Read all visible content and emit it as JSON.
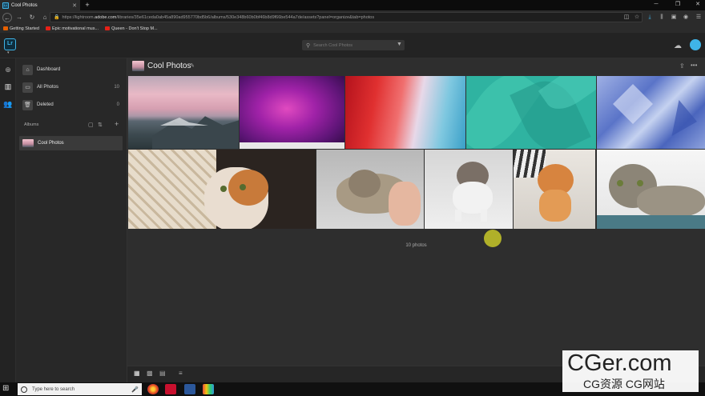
{
  "browser": {
    "tab_title": "Cool Photos",
    "tab_favicon_text": "Lr",
    "url_prefix": "https://lightroom.",
    "url_domain": "adobe.com",
    "url_rest": "/libraries/35e61ceda0ab45a890ad955770bd5b6/albums/530e348b60b0bf46b8d9f66be544a7de/assets?panel=organize&tab=photos",
    "bookmarks": [
      {
        "label": "Getting Started",
        "color": "#e66000"
      },
      {
        "label": "Epic motivational mus...",
        "color": "#e62117"
      },
      {
        "label": "Queen - Don't Stop M...",
        "color": "#e62117"
      }
    ]
  },
  "app": {
    "logo": "Lr",
    "search_placeholder": "Search Cool Photos",
    "accent_color": "#3fb4e8"
  },
  "sidebar": {
    "items": [
      {
        "label": "Dashboard",
        "count": "",
        "icon": "home-icon"
      },
      {
        "label": "All Photos",
        "count": "10",
        "icon": "photos-icon"
      },
      {
        "label": "Deleted",
        "count": "0",
        "icon": "trash-icon"
      }
    ],
    "albums_header": "Albums",
    "albums": [
      {
        "label": "Cool Photos"
      }
    ]
  },
  "main": {
    "album_title": "Cool Photos",
    "photo_count": "10 photos",
    "photos": [
      {
        "name": "pink-mountain-sky"
      },
      {
        "name": "purple-galaxy"
      },
      {
        "name": "red-blue-paint"
      },
      {
        "name": "teal-leaves"
      },
      {
        "name": "blue-crystal"
      },
      {
        "name": "kitten-in-basket"
      },
      {
        "name": "kitten-held-in-hand"
      },
      {
        "name": "kitten-standing"
      },
      {
        "name": "kitten-on-pillow"
      },
      {
        "name": "tabby-cat-lying"
      }
    ]
  },
  "taskbar": {
    "search_placeholder": "Type here to search"
  },
  "watermark": {
    "line1": "CGer.com",
    "line2": "CG资源 CG网站"
  }
}
